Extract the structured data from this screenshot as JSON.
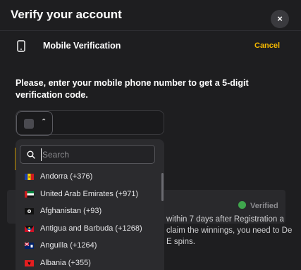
{
  "modal": {
    "title": "Verify your account",
    "close_label": "×",
    "section_label": "Mobile Verification",
    "cancel_label": "Cancel",
    "instruction": "Please, enter your mobile phone number to get a 5-digit verification code."
  },
  "phone": {
    "country_chevron": "⌃",
    "number_value": ""
  },
  "search": {
    "placeholder": "Search",
    "value": ""
  },
  "countries": [
    {
      "name": "Andorra (+376)",
      "flag": "andorra"
    },
    {
      "name": "United Arab Emirates (+971)",
      "flag": "uae"
    },
    {
      "name": "Afghanistan (+93)",
      "flag": "afghanistan"
    },
    {
      "name": "Antigua and Barbuda (+1268)",
      "flag": "antigua"
    },
    {
      "name": "Anguilla (+1264)",
      "flag": "anguilla"
    },
    {
      "name": "Albania (+355)",
      "flag": "albania"
    }
  ],
  "background": {
    "verified_label": "Verified",
    "text_lines": [
      "within 7 days after Registration a",
      "claim the winnings, you need to De",
      "E spins."
    ]
  },
  "colors": {
    "accent": "#f5b800",
    "verified": "#3fa64d",
    "background": "#1e1e20"
  }
}
